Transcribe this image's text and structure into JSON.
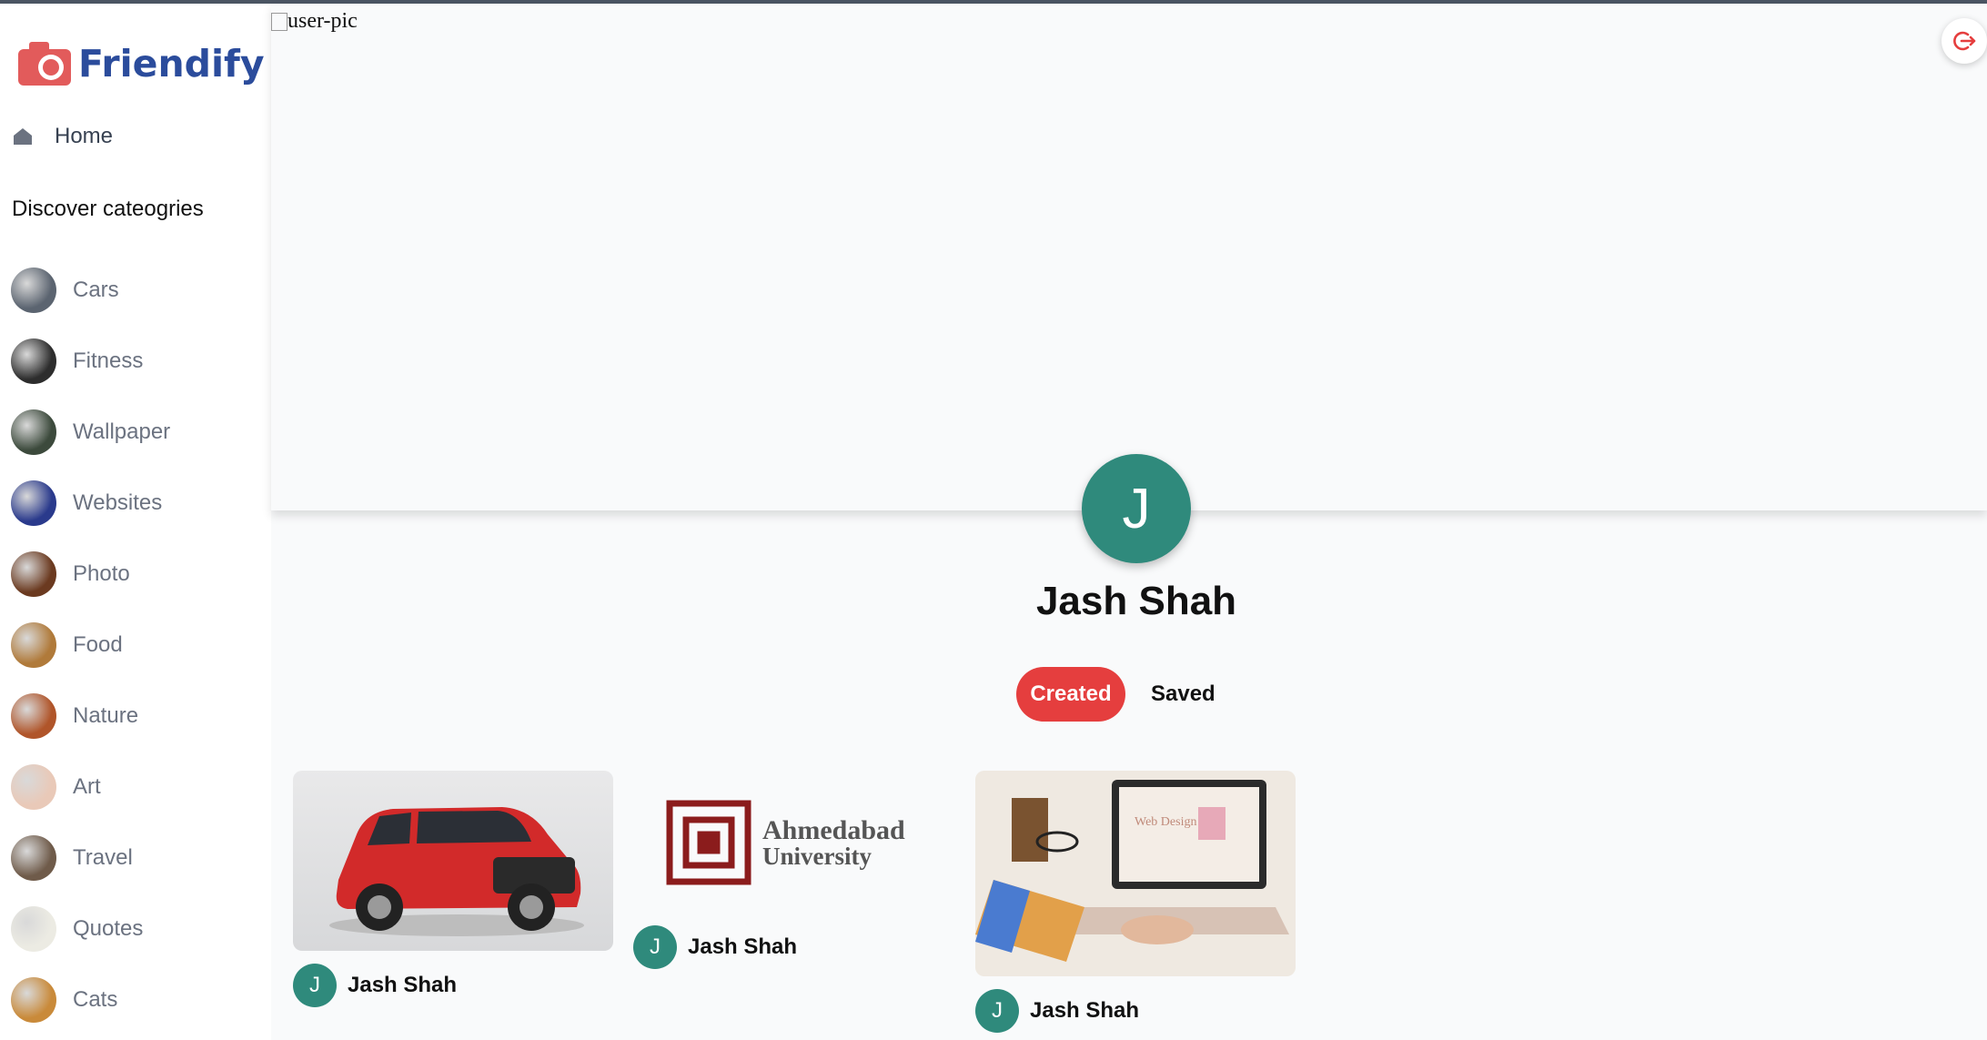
{
  "app": {
    "name": "Friendify"
  },
  "sidebar": {
    "home_label": "Home",
    "discover_heading": "Discover cateogries",
    "categories": [
      {
        "label": "Cars",
        "color": "#5b6470"
      },
      {
        "label": "Fitness",
        "color": "#2d2d2d"
      },
      {
        "label": "Wallpaper",
        "color": "#3c4a3c"
      },
      {
        "label": "Websites",
        "color": "#2a3a8c"
      },
      {
        "label": "Photo",
        "color": "#6b3a20"
      },
      {
        "label": "Food",
        "color": "#b07a3a"
      },
      {
        "label": "Nature",
        "color": "#b0552a"
      },
      {
        "label": "Art",
        "color": "#e9c9b8"
      },
      {
        "label": "Travel",
        "color": "#6f5b4a"
      },
      {
        "label": "Quotes",
        "color": "#ecebe3"
      },
      {
        "label": "Cats",
        "color": "#c98a3a"
      }
    ]
  },
  "cover": {
    "alt_text": "user-pic"
  },
  "profile": {
    "initial": "J",
    "name": "Jash Shah",
    "tabs": {
      "created": "Created",
      "saved": "Saved"
    }
  },
  "pins": [
    {
      "user_initial": "J",
      "user_name": "Jash Shah",
      "image": "red-suv-photo"
    },
    {
      "user_initial": "J",
      "user_name": "Jash Shah",
      "image": "ahmedabad-university-logo",
      "logo_text_line1": "Ahmedabad",
      "logo_text_line2": "University"
    },
    {
      "user_initial": "J",
      "user_name": "Jash Shah",
      "image": "web-design-laptop-photo",
      "laptop_text": "Web Design"
    }
  ],
  "colors": {
    "accent": "#e53e3e",
    "avatar": "#2f8a7c",
    "brand": "#2b4c9c"
  }
}
